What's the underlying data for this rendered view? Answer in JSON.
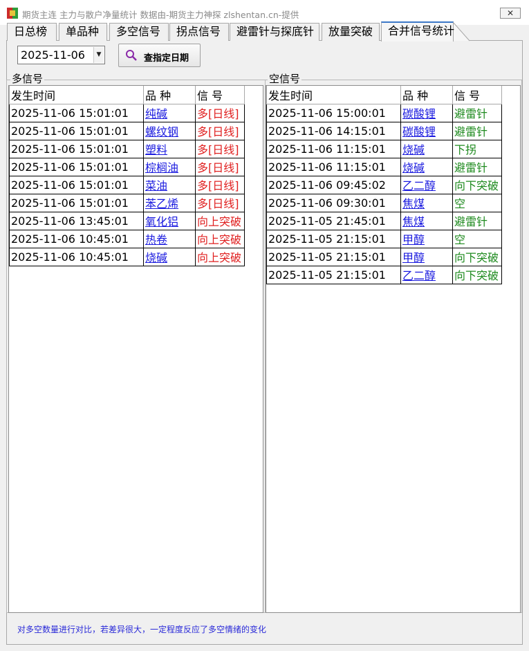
{
  "window": {
    "title": "期货主连 主力与散户净量统计 数据由-期货主力神探 zlshentan.cn-提供",
    "close_glyph": "✕"
  },
  "tabs": [
    {
      "label": "日总榜",
      "active": false
    },
    {
      "label": "单品种",
      "active": false
    },
    {
      "label": "多空信号",
      "active": false
    },
    {
      "label": "拐点信号",
      "active": false
    },
    {
      "label": "避雷针与探底针",
      "active": false
    },
    {
      "label": "放量突破",
      "active": false
    },
    {
      "label": "合并信号统计",
      "active": true
    }
  ],
  "toolbar": {
    "date_value": "2025-11-06",
    "query_button_label": "查指定日期",
    "query_icon": "search-icon"
  },
  "long_panel": {
    "title": "多信号",
    "headers": [
      "发生时间",
      "品 种",
      "信 号"
    ],
    "rows": [
      {
        "time": "2025-11-06 15:01:01",
        "product": "纯碱",
        "signal": "多[日线]"
      },
      {
        "time": "2025-11-06 15:01:01",
        "product": "螺纹钢",
        "signal": "多[日线]"
      },
      {
        "time": "2025-11-06 15:01:01",
        "product": "塑料",
        "signal": "多[日线]"
      },
      {
        "time": "2025-11-06 15:01:01",
        "product": "棕榈油",
        "signal": "多[日线]"
      },
      {
        "time": "2025-11-06 15:01:01",
        "product": "菜油",
        "signal": "多[日线]"
      },
      {
        "time": "2025-11-06 15:01:01",
        "product": "苯乙烯",
        "signal": "多[日线]"
      },
      {
        "time": "2025-11-06 13:45:01",
        "product": "氧化铝",
        "signal": "向上突破"
      },
      {
        "time": "2025-11-06 10:45:01",
        "product": "热卷",
        "signal": "向上突破"
      },
      {
        "time": "2025-11-06 10:45:01",
        "product": "烧碱",
        "signal": "向上突破"
      }
    ]
  },
  "short_panel": {
    "title": "空信号",
    "headers": [
      "发生时间",
      "品 种",
      "信 号"
    ],
    "rows": [
      {
        "time": "2025-11-06 15:00:01",
        "product": "碳酸锂",
        "signal": "避雷针"
      },
      {
        "time": "2025-11-06 14:15:01",
        "product": "碳酸锂",
        "signal": "避雷针"
      },
      {
        "time": "2025-11-06 11:15:01",
        "product": "烧碱",
        "signal": "下拐"
      },
      {
        "time": "2025-11-06 11:15:01",
        "product": "烧碱",
        "signal": "避雷针"
      },
      {
        "time": "2025-11-06 09:45:02",
        "product": "乙二醇",
        "signal": "向下突破"
      },
      {
        "time": "2025-11-06 09:30:01",
        "product": "焦煤",
        "signal": "空"
      },
      {
        "time": "2025-11-05 21:45:01",
        "product": "焦煤",
        "signal": "避雷针"
      },
      {
        "time": "2025-11-05 21:15:01",
        "product": "甲醇",
        "signal": "空"
      },
      {
        "time": "2025-11-05 21:15:01",
        "product": "甲醇",
        "signal": "向下突破"
      },
      {
        "time": "2025-11-05 21:15:01",
        "product": "乙二醇",
        "signal": "向下突破"
      }
    ]
  },
  "footer": {
    "note": "对多空数量进行对比，若差异很大，一定程度反应了多空情绪的变化"
  },
  "colors": {
    "long_signal": "#e02020",
    "short_signal": "#1e8a1e",
    "product_link": "#1a1adf",
    "footer_text": "#2a2ad8",
    "active_tab_accent": "#3c78c8"
  }
}
